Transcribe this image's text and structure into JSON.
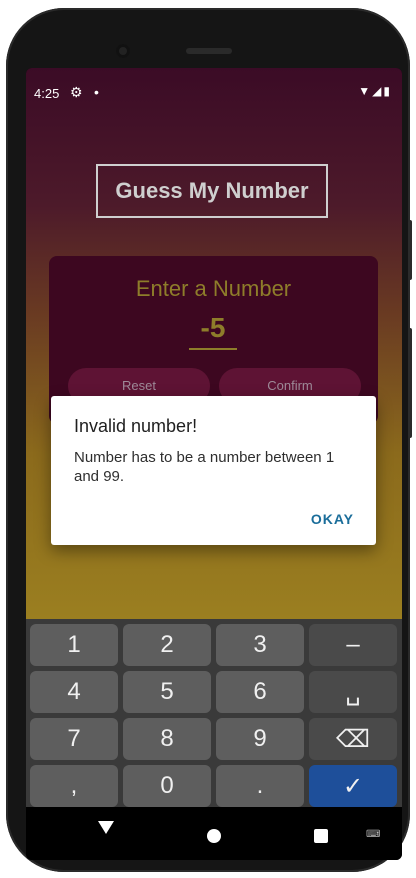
{
  "status_bar": {
    "time": "4:25",
    "icons": [
      "settings-icon",
      "notification-dot-icon",
      "wifi-icon",
      "signal-icon",
      "battery-icon"
    ]
  },
  "app": {
    "title": "Guess My Number",
    "input_label": "Enter a Number",
    "input_value": "-5",
    "buttons": {
      "reset": "Reset",
      "confirm": "Confirm"
    }
  },
  "dialog": {
    "title": "Invalid number!",
    "message": "Number has to be a number between 1 and 99.",
    "button": "OKAY"
  },
  "keyboard": {
    "rows": [
      [
        "1",
        "2",
        "3",
        "–"
      ],
      [
        "4",
        "5",
        "6",
        "␣"
      ],
      [
        "7",
        "8",
        "9",
        "⌫"
      ],
      [
        ",",
        "0",
        ".",
        "✓"
      ]
    ]
  },
  "colors": {
    "accent": "#8e7d2a",
    "card_bg": "#3d0720",
    "done_key": "#1e4f9a",
    "dialog_button": "#1a6d9a"
  }
}
